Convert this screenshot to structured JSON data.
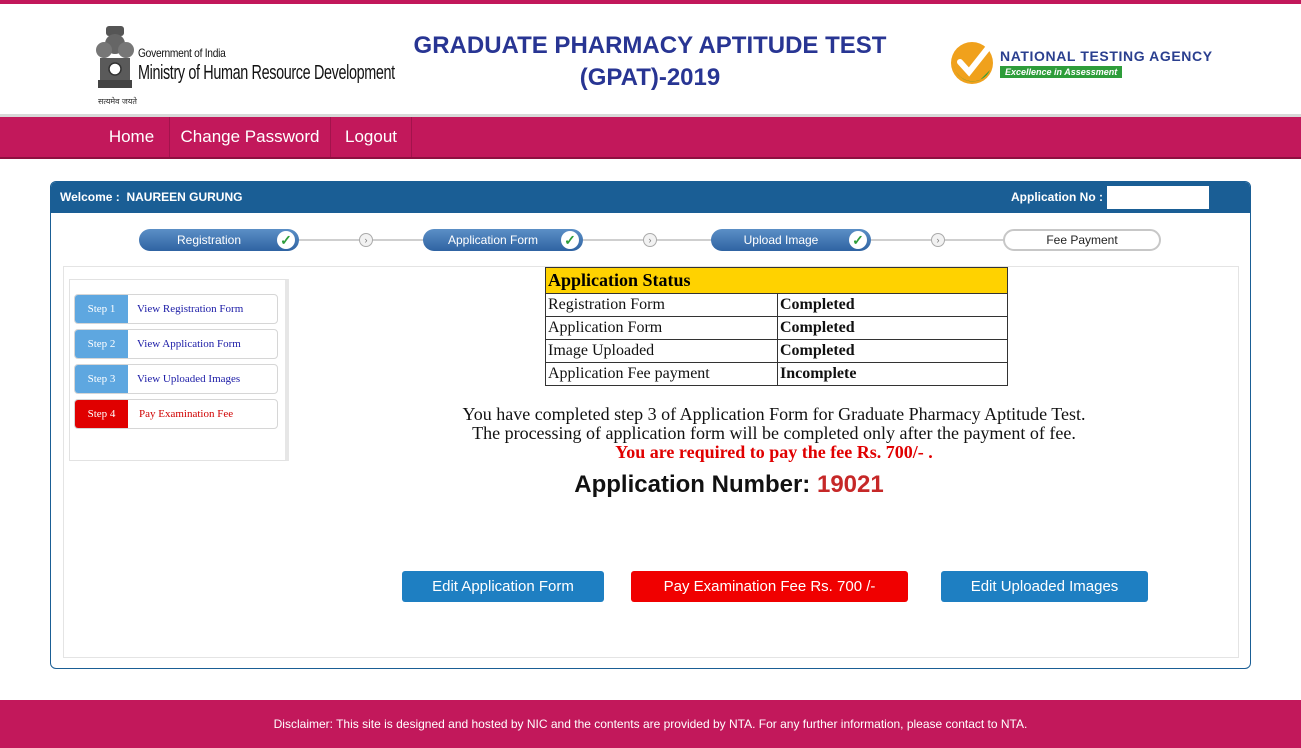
{
  "header": {
    "moe_line1": "Government of India",
    "moe_line2": "Ministry of Human Resource Development",
    "moe_hindi": "सत्यमेव जयते",
    "title_line1": "GRADUATE PHARMACY APTITUDE TEST",
    "title_line2": "(GPAT)-2019",
    "nta_name": "NATIONAL TESTING AGENCY",
    "nta_tagline": "Excellence in Assessment"
  },
  "nav": {
    "items": [
      {
        "label": "Home"
      },
      {
        "label": "Change Password"
      },
      {
        "label": "Logout"
      }
    ]
  },
  "panel": {
    "welcome_label": "Welcome :",
    "welcome_name": "NAUREEN GURUNG",
    "appno_label": "Application No :"
  },
  "progress": {
    "steps": [
      {
        "label": "Registration",
        "done": true
      },
      {
        "label": "Application Form",
        "done": true
      },
      {
        "label": "Upload Image",
        "done": true
      },
      {
        "label": "Fee Payment",
        "done": false
      }
    ]
  },
  "sidebar": {
    "steps": [
      {
        "badge": "Step 1",
        "label": "View Registration Form"
      },
      {
        "badge": "Step 2",
        "label": "View Application Form"
      },
      {
        "badge": "Step 3",
        "label": "View Uploaded Images"
      },
      {
        "badge": "Step 4",
        "label": "Pay Examination Fee"
      }
    ]
  },
  "status_table": {
    "heading": "Application Status",
    "rows": [
      {
        "item": "Registration Form",
        "status": "Completed"
      },
      {
        "item": "Application Form",
        "status": "Completed"
      },
      {
        "item": "Image Uploaded",
        "status": "Completed"
      },
      {
        "item": "Application Fee payment",
        "status": "Incomplete"
      }
    ]
  },
  "message": {
    "line1": "You have completed step 3 of Application Form for Graduate Pharmacy Aptitude Test.",
    "line2": "The processing of application form will be completed only after the payment of fee.",
    "line3": "You are required to pay the fee Rs. 700/- ."
  },
  "application_number": {
    "label": "Application Number:",
    "value": "19021"
  },
  "buttons": {
    "edit_form": "Edit Application Form",
    "pay_fee": "Pay Examination Fee Rs. 700 /-",
    "edit_images": "Edit Uploaded Images"
  },
  "footer": {
    "text": "Disclaimer: This site is designed and hosted by NIC and the contents are provided by NTA. For any further information, please contact to NTA."
  },
  "colors": {
    "brand": "#c2185b",
    "panel_blue": "#1a5e95",
    "completed_green": "#1b7e1b",
    "alert_red": "#e00000"
  }
}
